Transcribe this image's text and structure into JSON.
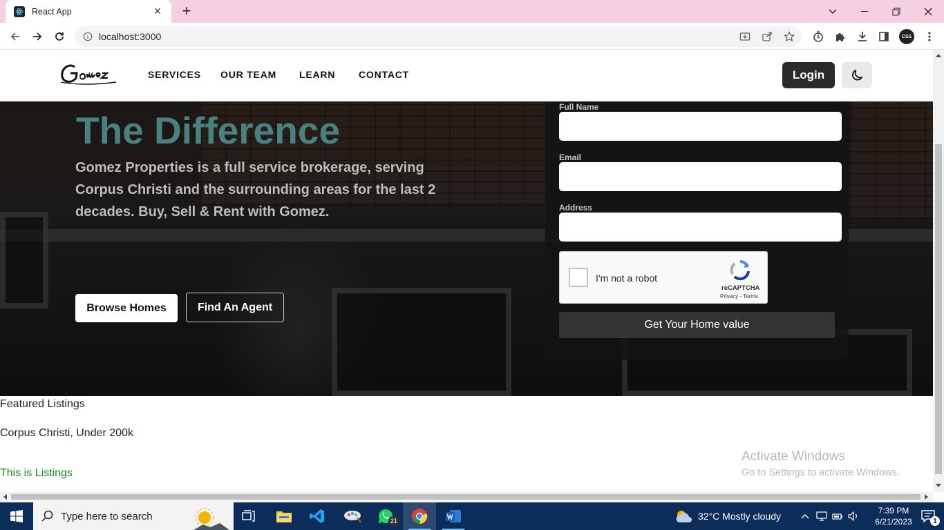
{
  "browser": {
    "tab_title": "React App",
    "url": "localhost:3000",
    "profile_initials": "CSS"
  },
  "site": {
    "nav": [
      "SERVICES",
      "OUR TEAM",
      "LEARN",
      "CONTACT"
    ],
    "login_label": "Login",
    "hero": {
      "title": "The Difference",
      "text": "Gomez Properties is a full service brokerage, serving Corpus Christi and the surrounding areas for the last 2 decades. Buy, Sell & Rent with Gomez.",
      "browse_label": "Browse Homes",
      "agent_label": "Find An Agent"
    },
    "form": {
      "full_name_label": "Full Name",
      "email_label": "Email",
      "address_label": "Address",
      "captcha_text": "I'm not a robot",
      "captcha_brand": "reCAPTCHA",
      "captcha_links": "Privacy - Terms",
      "submit_label": "Get Your Home value"
    },
    "featured_heading": "Featured Listings",
    "featured_subheading": "Corpus Christi, Under 200k",
    "listings_text": "This is Listings"
  },
  "watermark": {
    "title": "Activate Windows",
    "subtitle": "Go to Settings to activate Windows."
  },
  "taskbar": {
    "search_placeholder": "Type here to search",
    "whatsapp_badge": "21",
    "weather": "32°C  Mostly cloudy",
    "time": "7:39 PM",
    "date": "6/21/2023",
    "notification_count": "1"
  },
  "colors": {
    "tabstrip": "#f5cfe2",
    "hero_title": "#4b8080",
    "listings_text": "#1a8a1a",
    "taskbar": "#0c2d5a"
  }
}
